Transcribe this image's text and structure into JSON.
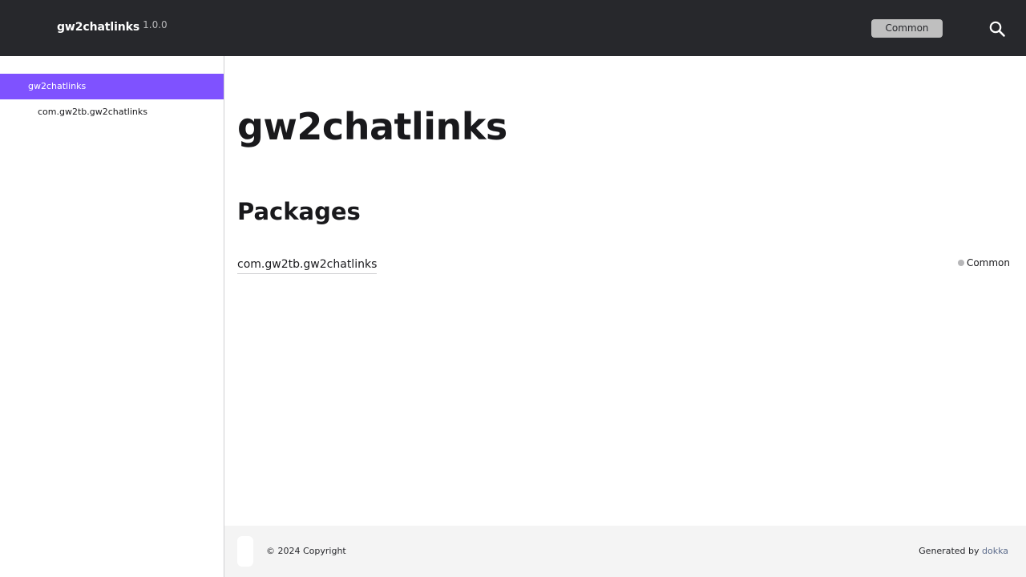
{
  "header": {
    "project_name": "gw2chatlinks",
    "version": "1.0.0",
    "platform_filter_label": "Common",
    "search_icon": "search-icon"
  },
  "sidebar": {
    "items": [
      {
        "label": "gw2chatlinks",
        "active": true
      },
      {
        "label": "com.gw2tb.gw2chatlinks",
        "active": false
      }
    ]
  },
  "main": {
    "title": "gw2chatlinks",
    "packages_heading": "Packages",
    "packages": [
      {
        "name": "com.gw2tb.gw2chatlinks",
        "platform": "Common"
      }
    ]
  },
  "footer": {
    "copyright": "© 2024 Copyright",
    "generated_by_prefix": "Generated by ",
    "generator_link": "dokka"
  },
  "colors": {
    "header_bg": "#27282c",
    "accent": "#7f52ff",
    "footer_bg": "#f4f4f4",
    "platform_dot": "#b6b6b8"
  }
}
